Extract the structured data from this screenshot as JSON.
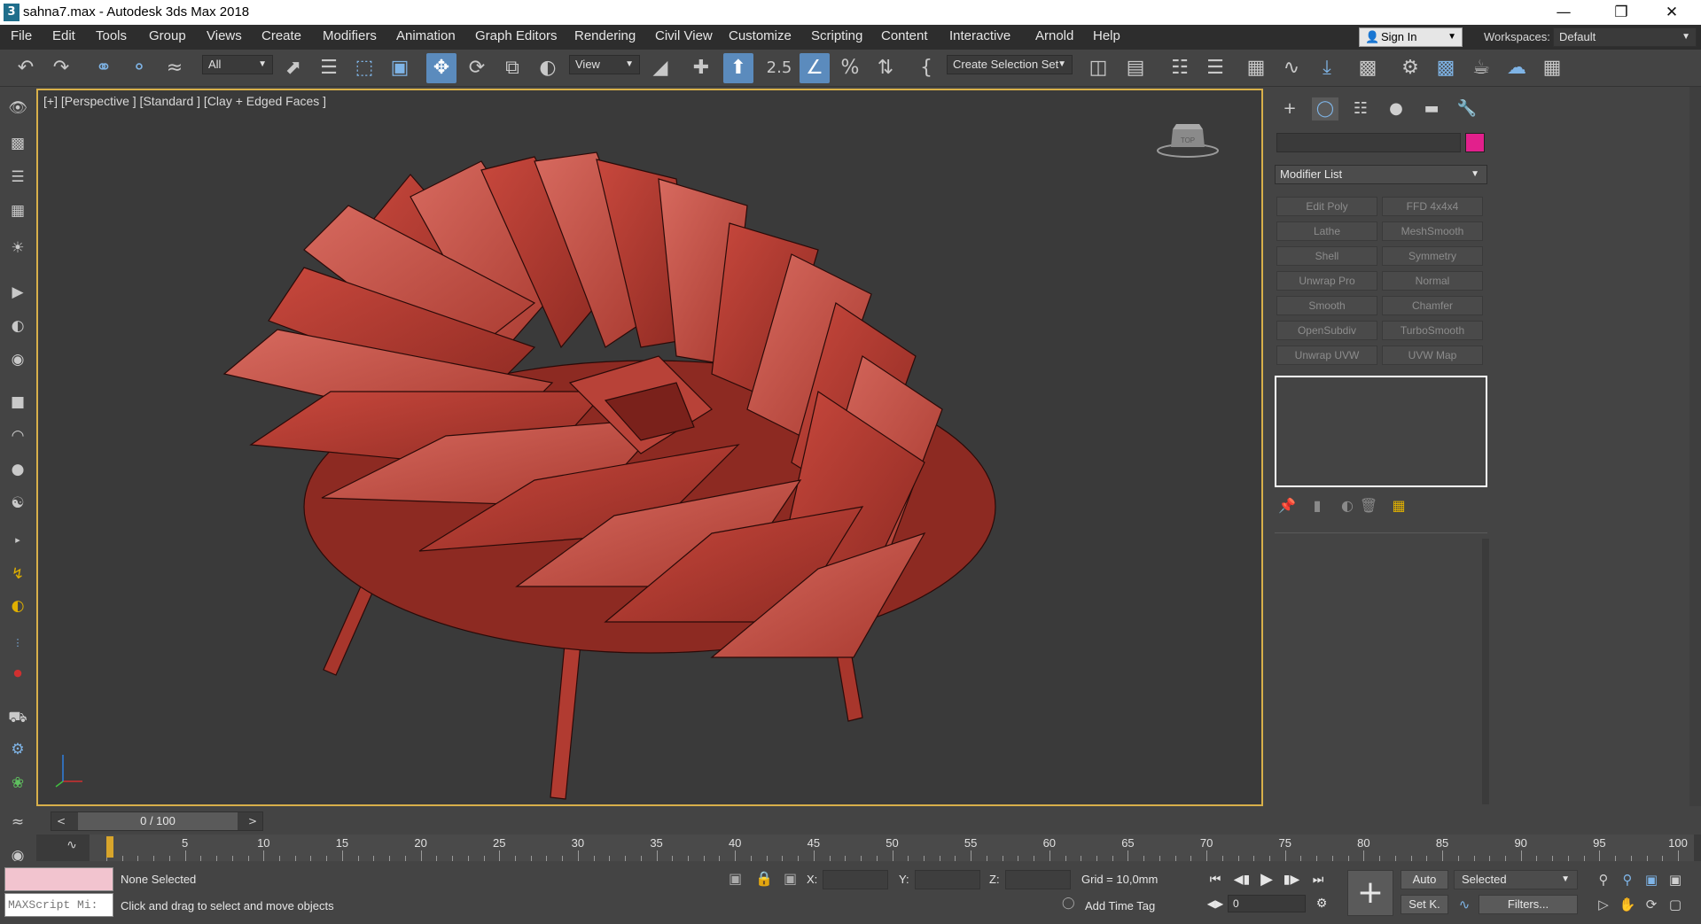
{
  "window": {
    "app_icon": "3",
    "title": "sahna7.max - Autodesk 3ds Max 2018",
    "controls": [
      "—",
      "❐",
      "✕"
    ]
  },
  "menu": [
    "File",
    "Edit",
    "Tools",
    "Group",
    "Views",
    "Create",
    "Modifiers",
    "Animation",
    "Graph Editors",
    "Rendering",
    "Civil View",
    "Customize",
    "Scripting",
    "Content",
    "Interactive",
    "Arnold",
    "Help"
  ],
  "account": {
    "signin_label": "Sign In",
    "workspaces_label": "Workspaces:",
    "workspace_value": "Default"
  },
  "toolbar": {
    "filter_value": "All",
    "ref_coord_value": "View",
    "selection_set_value": "Create Selection Set",
    "snap_label": "2.5"
  },
  "viewport": {
    "label": "[+] [Perspective ] [Standard ] [Clay + Edged Faces ]",
    "viewcube_label": "TOP",
    "model_color": "#b03b32",
    "bg_color": "#3a3a3a"
  },
  "command_panel": {
    "object_color": "#e2208c",
    "modifier_list_label": "Modifier List",
    "modifier_buttons": [
      "Edit Poly",
      "FFD 4x4x4",
      "Lathe",
      "MeshSmooth",
      "Shell",
      "Symmetry",
      "Unwrap Pro",
      "Normal",
      "Smooth",
      "Chamfer",
      "OpenSubdiv",
      "TurboSmooth",
      "Unwrap UVW",
      "UVW Map"
    ]
  },
  "time_slider": {
    "value": "0 / 100",
    "prev": "<",
    "next": ">"
  },
  "track_bar": {
    "labels": [
      "5",
      "10",
      "15",
      "20",
      "25",
      "30",
      "35",
      "40",
      "45",
      "50",
      "55",
      "60",
      "65",
      "70",
      "75",
      "80",
      "85",
      "90",
      "95",
      "100"
    ]
  },
  "status": {
    "maxscript_placeholder": "MAXScript Mi:",
    "selection": "None Selected",
    "prompt": "Click and drag to select and move objects",
    "x_label": "X:",
    "y_label": "Y:",
    "z_label": "Z:",
    "grid": "Grid = 10,0mm",
    "add_time_tag": "Add Time Tag",
    "frame_value": "0",
    "auto_key": "Auto",
    "set_key": "Set K.",
    "key_filter_value": "Selected",
    "filters": "Filters..."
  }
}
